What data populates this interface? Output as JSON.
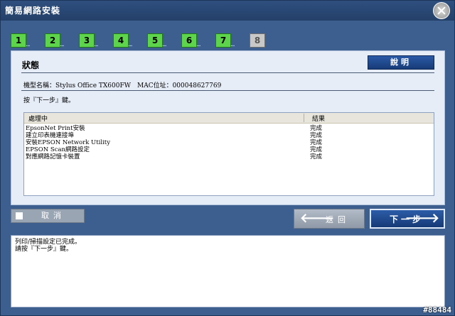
{
  "window": {
    "title": "簡易網路安裝"
  },
  "steps": {
    "items": [
      {
        "label": "1",
        "state": "done"
      },
      {
        "label": "2",
        "state": "done"
      },
      {
        "label": "3",
        "state": "done"
      },
      {
        "label": "4",
        "state": "done"
      },
      {
        "label": "5",
        "state": "done"
      },
      {
        "label": "6",
        "state": "done"
      },
      {
        "label": "7",
        "state": "done"
      },
      {
        "label": "8",
        "state": "current"
      }
    ],
    "dots": "..."
  },
  "panel": {
    "title": "狀態",
    "help_label": "說明",
    "model_info": "機型名稱：Stylus Office TX600FW　MAC位址：000048627769",
    "prompt": "按『下一步』鍵。",
    "table": {
      "headers": [
        "處理中",
        "結果"
      ],
      "rows": [
        {
          "task": "EpsonNet Print安裝",
          "result": "完成"
        },
        {
          "task": "建立印表機連接埠",
          "result": "完成"
        },
        {
          "task": "安裝EPSON Network Utility",
          "result": "完成"
        },
        {
          "task": "EPSON Scan網路設定",
          "result": "完成"
        },
        {
          "task": "對應網路記憶卡裝置",
          "result": "完成"
        }
      ]
    }
  },
  "buttons": {
    "cancel": "取消",
    "back": "返回",
    "next": "下一步"
  },
  "message": {
    "lines": [
      "列印/掃描設定已完成。",
      "請按『下一步』鍵。"
    ]
  },
  "watermark": "#88484",
  "colors": {
    "background": "#3d5f90",
    "step_done": "#5dd44b",
    "step_current": "#c8c8c8",
    "primary_button": "#1f4a91"
  }
}
